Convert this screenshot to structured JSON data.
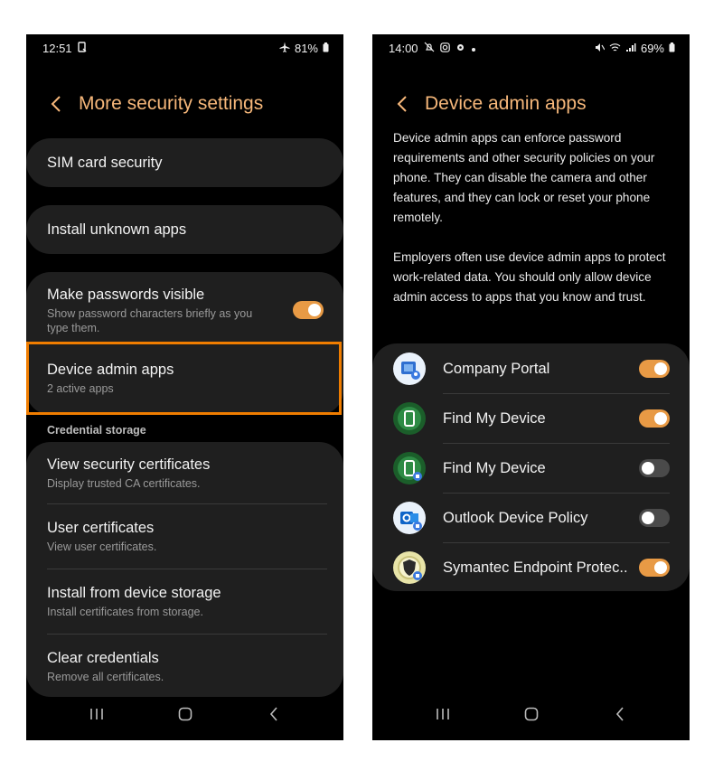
{
  "left": {
    "status": {
      "time": "12:51",
      "battery": "81%"
    },
    "title": "More security settings",
    "sim_card": "SIM card security",
    "install_unknown": "Install unknown apps",
    "passwords": {
      "title": "Make passwords visible",
      "subtitle": "Show password characters briefly as you type them.",
      "toggle": "on"
    },
    "device_admin": {
      "title": "Device admin apps",
      "subtitle": "2 active apps"
    },
    "credential_label": "Credential storage",
    "credentials": [
      {
        "title": "View security certificates",
        "subtitle": "Display trusted CA certificates."
      },
      {
        "title": "User certificates",
        "subtitle": "View user certificates."
      },
      {
        "title": "Install from device storage",
        "subtitle": "Install certificates from storage."
      },
      {
        "title": "Clear credentials",
        "subtitle": "Remove all certificates."
      }
    ],
    "highlight_color": "#f07d00"
  },
  "right": {
    "status": {
      "time": "14:00",
      "battery": "69%"
    },
    "title": "Device admin apps",
    "desc1": "Device admin apps can enforce password requirements and other security policies on your phone. They can disable the camera and other features, and they can lock or reset your phone remotely.",
    "desc2": "Employers often use device admin apps to protect work-related data. You should only allow device admin access to apps that you know and trust.",
    "apps": [
      {
        "name": "Company Portal",
        "enabled": true,
        "icon": "company-portal-icon"
      },
      {
        "name": "Find My Device",
        "enabled": true,
        "icon": "find-my-device-icon"
      },
      {
        "name": "Find My Device",
        "enabled": false,
        "icon": "find-my-device-work-icon"
      },
      {
        "name": "Outlook Device Policy",
        "enabled": false,
        "icon": "outlook-icon"
      },
      {
        "name": "Symantec Endpoint Protec..",
        "enabled": true,
        "icon": "symantec-icon"
      }
    ]
  },
  "colors": {
    "accent": "#f6b77a",
    "toggle_on": "#e89a45",
    "toggle_off": "#4a4a4a",
    "card": "#1f1f1f"
  }
}
